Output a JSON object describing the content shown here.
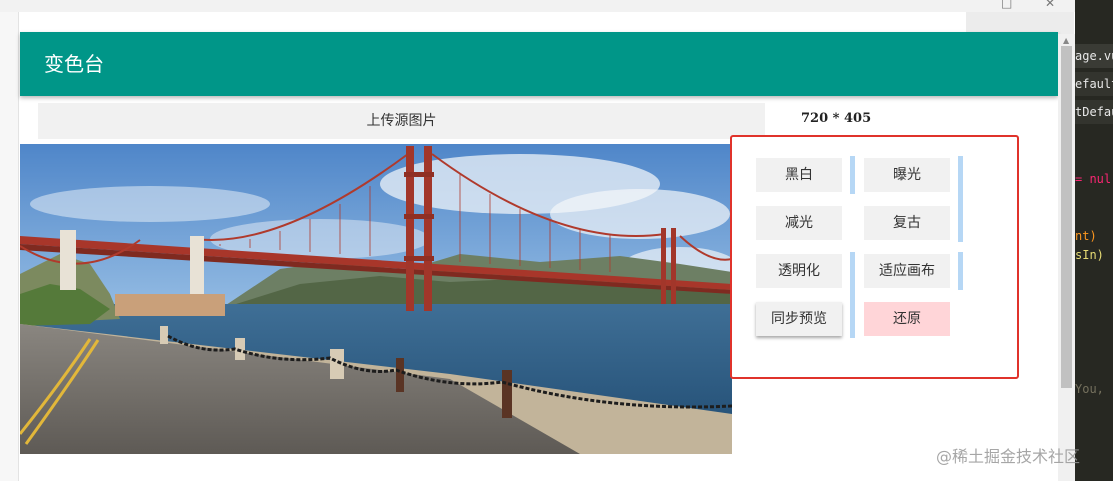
{
  "app": {
    "title": "变色台"
  },
  "toolbar": {
    "upload_label": "上传源图片",
    "dimensions": "720 * 405"
  },
  "filters": {
    "black_white": "黑白",
    "exposure": "曝光",
    "reduce_light": "减光",
    "vintage": "复古",
    "transparent": "透明化",
    "fit_canvas": "适应画布",
    "sync_preview": "同步预览",
    "restore": "还原"
  },
  "editor": {
    "tab1": "age.vue",
    "tab2": "efault(",
    "tab3": "tDefaul",
    "line1": "= nul",
    "line2": "nt)",
    "line3": "sIn)",
    "line4": "You,"
  },
  "watermark": "@稀土掘金技术社区",
  "colors": {
    "appbar": "#009688",
    "highlight_border": "#e0332b",
    "restore_button": "#ffd5d8"
  },
  "icons": {
    "close": "close-icon",
    "minimize": "minimize-icon"
  },
  "window_controls": {
    "minimize": "□",
    "close": "✕"
  }
}
